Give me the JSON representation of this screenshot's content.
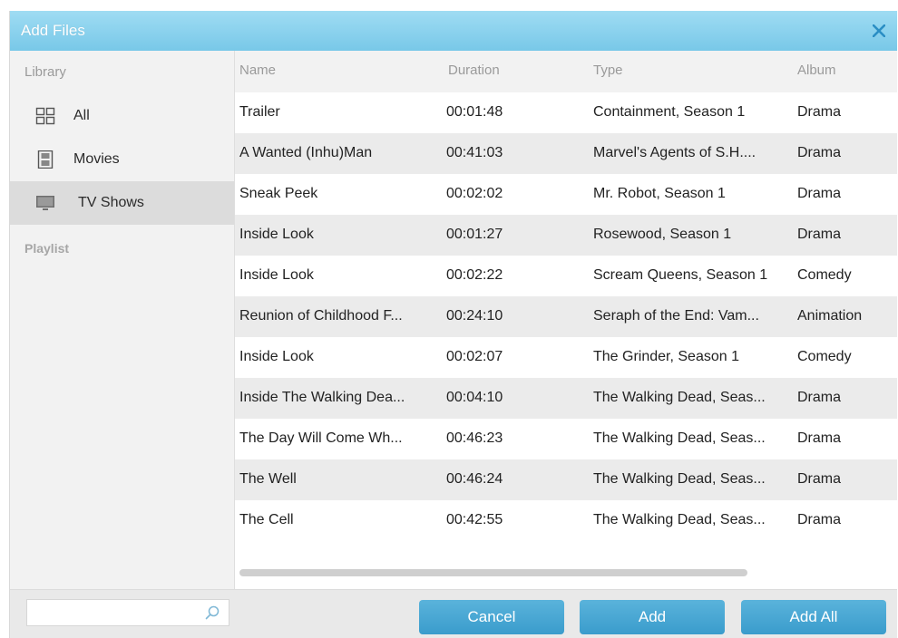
{
  "window": {
    "title": "Add Files",
    "close_icon": "close-icon"
  },
  "sidebar": {
    "library_heading": "Library",
    "items": [
      {
        "label": "All",
        "icon": "grid-icon"
      },
      {
        "label": "Movies",
        "icon": "film-icon"
      },
      {
        "label": "TV Shows",
        "icon": "monitor-icon",
        "selected": true
      }
    ],
    "playlist_heading": "Playlist"
  },
  "table": {
    "columns": [
      "Name",
      "Duration",
      "Type",
      "Album"
    ],
    "rows": [
      [
        "Trailer",
        "00:01:48",
        "Containment, Season 1",
        "Drama"
      ],
      [
        "A Wanted (Inhu)Man",
        "00:41:03",
        "Marvel's Agents of S.H....",
        "Drama"
      ],
      [
        "Sneak Peek",
        "00:02:02",
        "Mr. Robot, Season 1",
        "Drama"
      ],
      [
        "Inside Look",
        "00:01:27",
        "Rosewood, Season 1",
        "Drama"
      ],
      [
        "Inside Look",
        "00:02:22",
        "Scream Queens, Season 1",
        "Comedy"
      ],
      [
        "Reunion of Childhood F...",
        "00:24:10",
        "Seraph of the End: Vam...",
        "Animation"
      ],
      [
        "Inside Look",
        "00:02:07",
        "The Grinder, Season 1",
        "Comedy"
      ],
      [
        "Inside The Walking Dea...",
        "00:04:10",
        "The Walking Dead, Seas...",
        "Drama"
      ],
      [
        "The Day Will Come Wh...",
        "00:46:23",
        "The Walking Dead, Seas...",
        "Drama"
      ],
      [
        "The Well",
        "00:46:24",
        "The Walking Dead, Seas...",
        "Drama"
      ],
      [
        "The Cell",
        "00:42:55",
        "The Walking Dead, Seas...",
        "Drama"
      ]
    ]
  },
  "footer": {
    "search": {
      "value": "",
      "placeholder": "",
      "icon": "search-icon"
    },
    "cancel_label": "Cancel",
    "add_label": "Add",
    "add_all_label": "Add All"
  },
  "colors": {
    "titlebar": "#8fd4f0",
    "button": "#4aa8d4",
    "sidebar_bg": "#f2f2f2",
    "selected_bg": "#dcdcdc"
  }
}
